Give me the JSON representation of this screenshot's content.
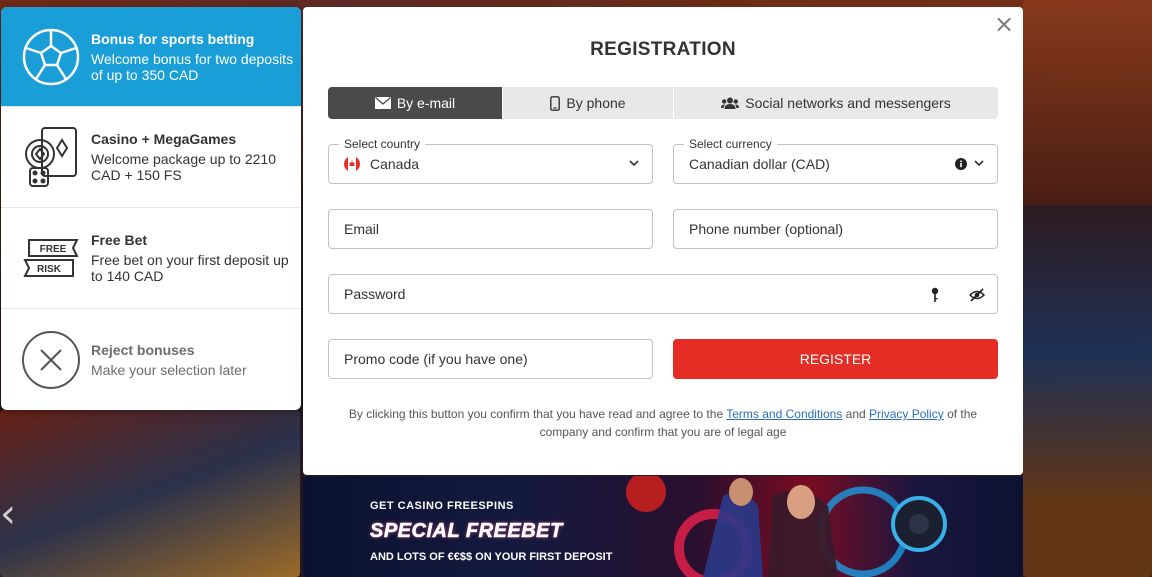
{
  "bonuses": [
    {
      "title": "Bonus for sports betting",
      "desc": "Welcome bonus for two deposits of up to 350 CAD",
      "icon": "soccer-ball-icon",
      "active": true
    },
    {
      "title": "Casino + MegaGames",
      "desc": "Welcome package up to 2210 CAD + 150 FS",
      "icon": "casino-chips-icon",
      "active": false
    },
    {
      "title": "Free Bet",
      "desc": "Free bet on your first deposit up to 140 CAD",
      "icon": "free-bet-icon",
      "active": false
    },
    {
      "title": "Reject bonuses",
      "desc": "Make your selection later",
      "icon": "reject-icon",
      "active": false
    }
  ],
  "free_bet_icon_text": {
    "free": "FREE",
    "risk": "RISK"
  },
  "registration": {
    "title": "REGISTRATION",
    "close": "×",
    "tabs": [
      {
        "label": "By e-mail",
        "icon": "envelope-icon",
        "active": true
      },
      {
        "label": "By phone",
        "icon": "phone-icon",
        "active": false
      },
      {
        "label": "Social networks and messengers",
        "icon": "users-icon",
        "active": false
      }
    ],
    "country": {
      "label": "Select country",
      "value": "Canada"
    },
    "currency": {
      "label": "Select currency",
      "value": "Canadian dollar (CAD)"
    },
    "email": {
      "placeholder": "Email"
    },
    "phone": {
      "placeholder": "Phone number (optional)"
    },
    "password": {
      "placeholder": "Password"
    },
    "promo": {
      "placeholder": "Promo code (if you have one)"
    },
    "register_label": "REGISTER",
    "terms": {
      "before": "By clicking this button you confirm that you have read and agree to the",
      "terms_link": "Terms and Conditions",
      "and": "and",
      "privacy_link": "Privacy Policy",
      "after": "of the company and confirm that you are of legal age"
    }
  },
  "banner": {
    "line1": "GET CASINO FREESPINS",
    "line2": "SPECIAL FREEBET",
    "line3": "AND LOTS OF €€$$ ON YOUR FIRST DEPOSIT"
  },
  "colors": {
    "accent_blue": "#1a9ed8",
    "register_red": "#e42d24",
    "active_tab": "#4a4a4a",
    "link": "#2a6ebb"
  }
}
